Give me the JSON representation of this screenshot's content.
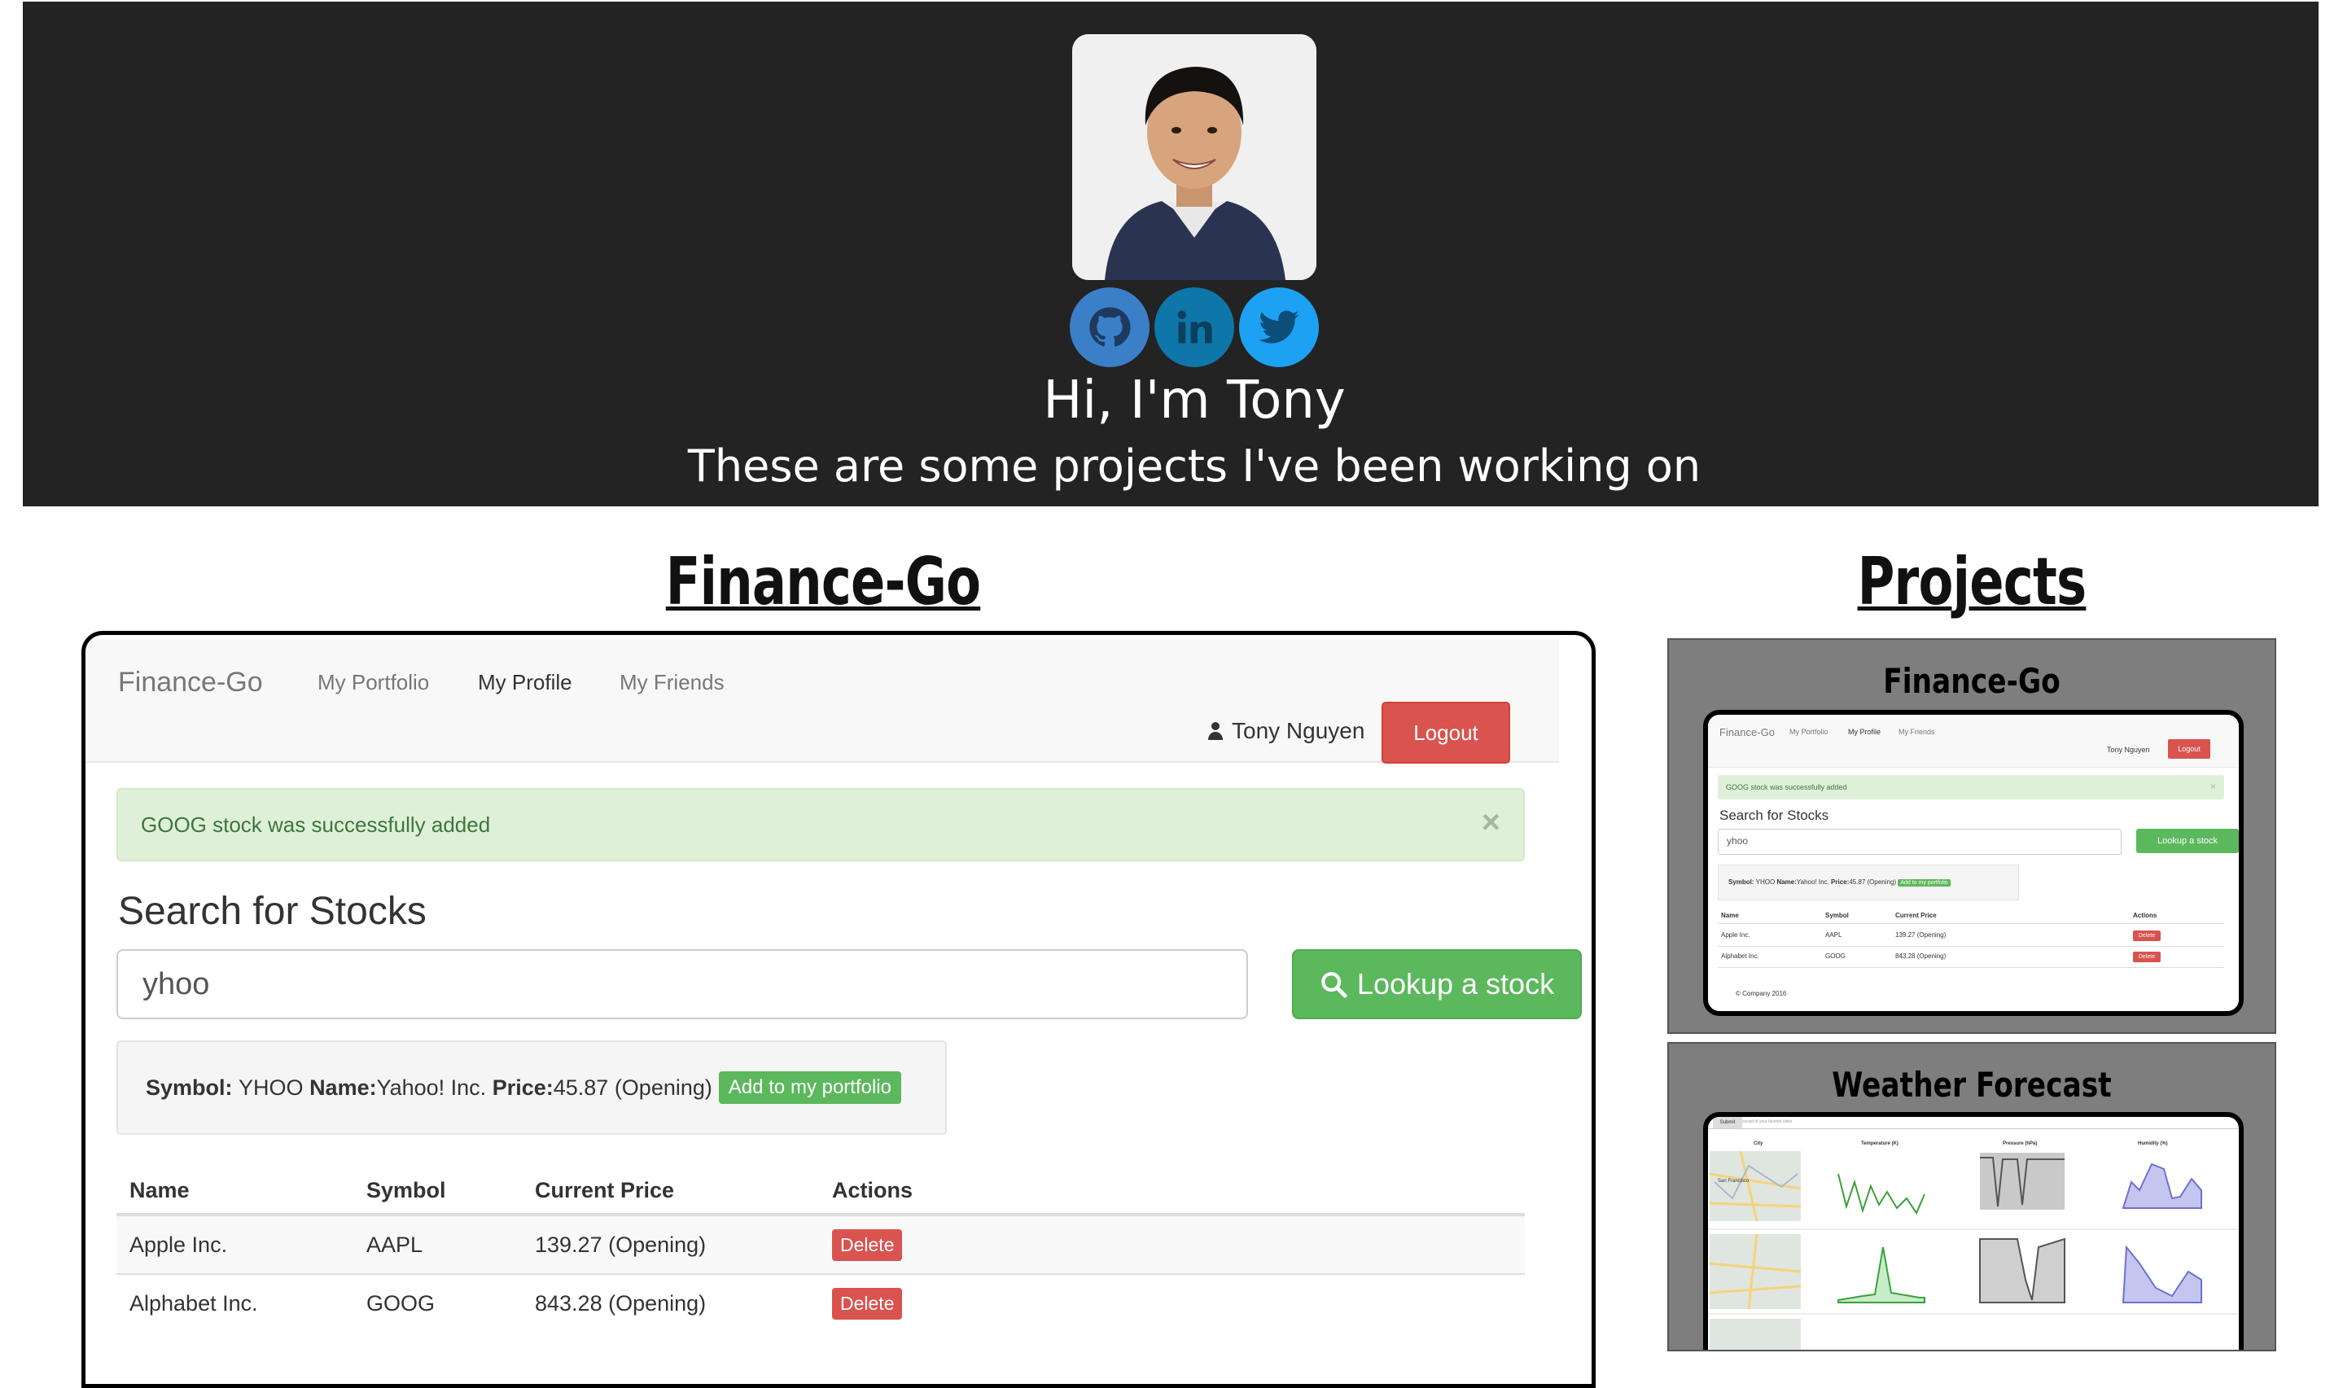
{
  "hero": {
    "greeting": "Hi, I'm Tony",
    "subtitle": "These are some projects I've been working on",
    "avatar_alt": "Portrait of Tony",
    "social": [
      {
        "name": "GitHub",
        "icon": "github-icon",
        "color": "#3b7fc9"
      },
      {
        "name": "LinkedIn",
        "icon": "linkedin-icon",
        "color": "#0e76a8"
      },
      {
        "name": "Twitter",
        "icon": "twitter-icon",
        "color": "#1da1f2"
      }
    ]
  },
  "sections": {
    "featured_title": "Finance-Go",
    "projects_title": "Projects"
  },
  "app": {
    "brand": "Finance-Go",
    "nav": [
      "My Portfolio",
      "My Profile",
      "My Friends"
    ],
    "active_nav": "My Profile",
    "user_name": "Tony Nguyen",
    "logout_label": "Logout",
    "alert_text": "GOOG stock was successfully added",
    "alert_close": "×",
    "search_heading": "Search for Stocks",
    "search_value": "yhoo",
    "lookup_label": "Lookup a stock",
    "result": {
      "symbol_label": "Symbol:",
      "symbol": "YHOO",
      "name_label": "Name:",
      "name": "Yahoo! Inc.",
      "price_label": "Price:",
      "price": "45.87 (Opening)",
      "add_label": "Add to my portfolio"
    },
    "table": {
      "headers": [
        "Name",
        "Symbol",
        "Current Price",
        "Actions"
      ],
      "rows": [
        {
          "name": "Apple Inc.",
          "symbol": "AAPL",
          "price": "139.27 (Opening)",
          "action": "Delete"
        },
        {
          "name": "Alphabet Inc.",
          "symbol": "GOOG",
          "price": "843.28 (Opening)",
          "action": "Delete"
        }
      ]
    }
  },
  "projects": [
    {
      "title": "Finance-Go",
      "preview": {
        "brand": "Finance-Go",
        "nav": [
          "My Portfolio",
          "My Profile",
          "My Friends"
        ],
        "user": "Tony Nguyen",
        "logout": "Logout",
        "alert": "GOOG stock was successfully added",
        "alert_close": "×",
        "heading": "Search for Stocks",
        "input": "yhoo",
        "lookup": "Lookup a stock",
        "result_symbol_label": "Symbol:",
        "result_symbol": "YHOO",
        "result_name_label": "Name:",
        "result_name": "Yahoo! Inc.",
        "result_price_label": "Price:",
        "result_price": "45.87 (Opening)",
        "add": "Add to my portfolio",
        "headers": [
          "Name",
          "Symbol",
          "Current Price",
          "Actions"
        ],
        "rows": [
          {
            "name": "Apple Inc.",
            "symbol": "AAPL",
            "price": "139.27 (Opening)",
            "action": "Delete"
          },
          {
            "name": "Alphabet Inc.",
            "symbol": "GOOG",
            "price": "843.28 (Opening)",
            "action": "Delete"
          }
        ],
        "footer": "© Company 2016"
      }
    },
    {
      "title": "Weather Forecast",
      "preview": {
        "search_placeholder": "Get a five day forecast of your favorite cities",
        "submit": "Submit",
        "headers": [
          "City",
          "Temperature (K)",
          "Pressure (hPa)",
          "Humidity (%)"
        ],
        "first_city": "San Francisco"
      }
    }
  ]
}
